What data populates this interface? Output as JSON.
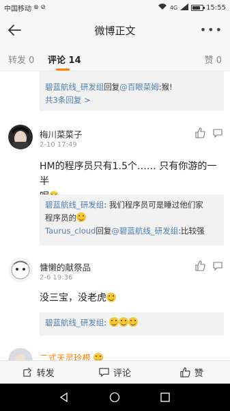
{
  "status": {
    "carrier": "中国移动",
    "time": "15:55",
    "network": "4G"
  },
  "nav": {
    "title": "微博正文"
  },
  "tabs": {
    "repost": "转发 0",
    "comment": "评论 14",
    "like": "赞 0"
  },
  "top_partial": {
    "line1_link": "碧蓝航线_研发组",
    "line1_mid": "回复",
    "line1_link2": "@百眼菜姆",
    "line1_text": ":猴!",
    "more": "共3条回复 >"
  },
  "comments": [
    {
      "name": "梅川菜菜子",
      "time": "2-10 17:49",
      "text_line1": "HM的程序员只有1.5个…… 只有你游的一半",
      "text_line2": "呢",
      "replies": [
        {
          "author": "碧蓝航线_研发组",
          "text_a": ": 我们程序员可是睡过他们家",
          "text_b": "程序员的"
        },
        {
          "author": "Taurus_cloud",
          "mid": "回复",
          "target": "@碧蓝航线_研发组",
          "text": ":比较强"
        }
      ]
    },
    {
      "name": "慵懒的献祭品",
      "time": "2-6 19:36",
      "text": "没三宝，没老虎",
      "replies": [
        {
          "author": "碧蓝航线_研发组",
          "text": ":"
        }
      ]
    },
    {
      "name": "二式天灵玲根"
    }
  ],
  "bottom_bar": {
    "repost": "转发",
    "comment": "评论",
    "like": "赞"
  },
  "colors": {
    "accent": "#ff8200",
    "link": "#507daf"
  }
}
